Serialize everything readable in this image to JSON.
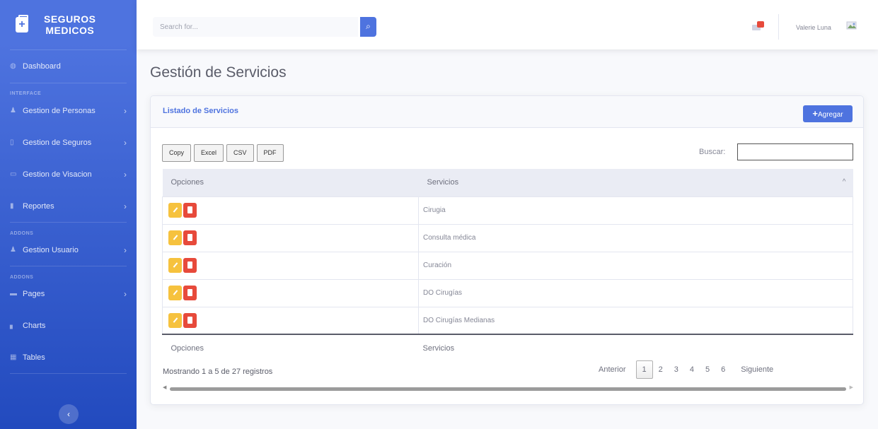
{
  "sidebar": {
    "brand": {
      "line1": "SEGUROS",
      "line2": "MEDICOS"
    },
    "dashboard": "Dashboard",
    "heading_interface": "INTERFACE",
    "items": [
      {
        "label": "Gestion de Personas",
        "icon": "users-icon"
      },
      {
        "label": "Gestion de Seguros",
        "icon": "file-icon"
      },
      {
        "label": "Gestion de Visacion",
        "icon": "card-icon"
      },
      {
        "label": "Reportes",
        "icon": "report-icon"
      }
    ],
    "heading_addons_1": "ADDONS",
    "usuario": "Gestion Usuario",
    "heading_addons_2": "ADDONS",
    "pages": "Pages",
    "charts": "Charts",
    "tables": "Tables",
    "toggle": "‹"
  },
  "topbar": {
    "search_placeholder": "Search for...",
    "user_name": "Valerie Luna"
  },
  "page": {
    "title": "Gestión de Servicios",
    "card_title": "Listado de Servicios",
    "add_label": "Agregar"
  },
  "table": {
    "export_buttons": [
      "Copy",
      "Excel",
      "CSV",
      "PDF"
    ],
    "filter_label": "Buscar:",
    "headers": [
      "Opciones",
      "Servicios"
    ],
    "rows": [
      "Cirugia",
      "Consulta médica",
      "Curación",
      "DO Cirugías",
      "DO Cirugías Medianas"
    ],
    "footer": [
      "Opciones",
      "Servicios"
    ],
    "info": "Mostrando 1 a 5 de 27 registros",
    "pagination": {
      "prev": "Anterior",
      "pages": [
        "1",
        "2",
        "3",
        "4",
        "5",
        "6"
      ],
      "next": "Siguiente",
      "current": "1"
    }
  },
  "colors": {
    "primary": "#4e73df",
    "warning": "#f6c23e",
    "danger": "#e74a3b"
  }
}
